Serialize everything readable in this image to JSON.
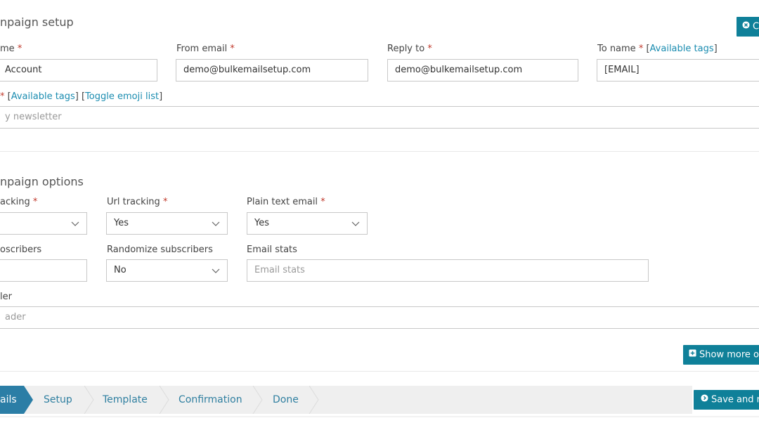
{
  "setup": {
    "title": "npaign setup",
    "close_label": "C",
    "name_label": "me",
    "name_value": "Account",
    "from_label": "From email",
    "from_value": "demo@bulkemailsetup.com",
    "reply_label": "Reply to",
    "reply_value": "demo@bulkemailsetup.com",
    "toname_label": "To name",
    "toname_tags": "Available tags",
    "toname_value": "[EMAIL]",
    "subject_tags": "Available tags",
    "subject_emoji": "Toggle emoji list",
    "subject_placeholder": "y newsletter",
    "required_mark": "*"
  },
  "options": {
    "title": "npaign options",
    "tracking_label": "acking",
    "url_tracking_label": "Url tracking",
    "url_tracking_value": "Yes",
    "plain_text_label": "Plain text email",
    "plain_text_value": "Yes",
    "subscribers_label": "oscribers",
    "randomize_label": "Randomize subscribers",
    "randomize_value": "No",
    "email_stats_label": "Email stats",
    "email_stats_placeholder": "Email stats",
    "header_label": "ler",
    "header_placeholder": "ader",
    "show_more_label": "Show more op"
  },
  "steps": {
    "items": [
      "ails",
      "Setup",
      "Template",
      "Confirmation",
      "Done"
    ],
    "save_label": "Save and ne"
  },
  "colors": {
    "accent": "#0f8099",
    "link": "#1a8cb0",
    "required": "#c0392b",
    "step_active": "#2f7fa0"
  }
}
